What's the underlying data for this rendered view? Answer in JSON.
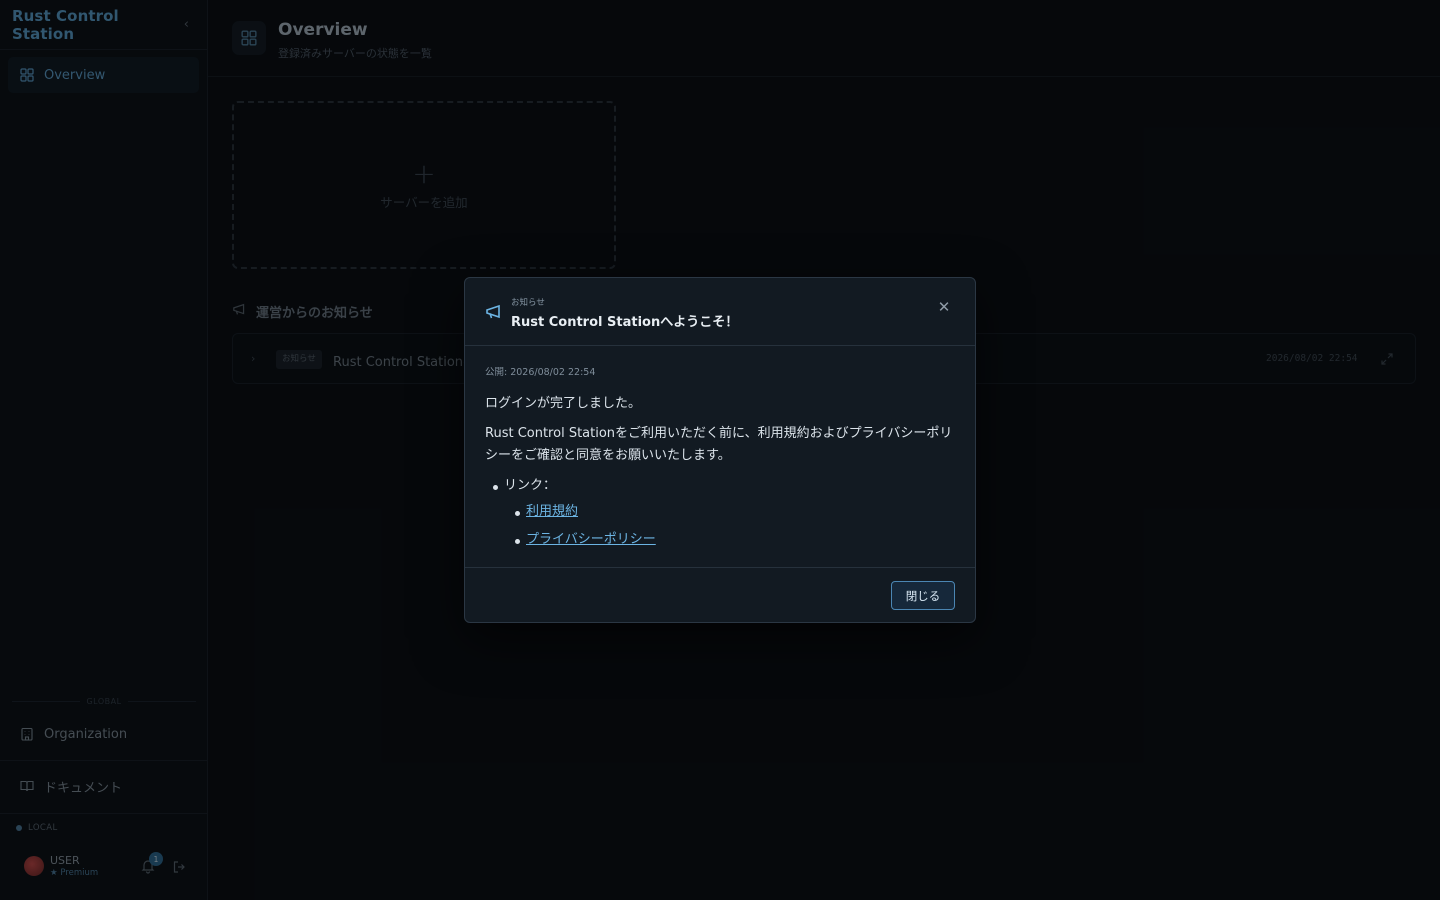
{
  "sidebar": {
    "title": "Rust Control Station",
    "nav": [
      {
        "label": "Overview",
        "icon": "grid-icon",
        "active": true
      },
      {
        "label": "Organization",
        "icon": "building-icon",
        "active": false
      },
      {
        "label": "ドキュメント",
        "icon": "book-icon",
        "active": false
      }
    ],
    "section_label": "GLOBAL",
    "env_label": "LOCAL",
    "user": {
      "name": "USER",
      "plan": "★ Premium",
      "notifications": "1"
    }
  },
  "header": {
    "title": "Overview",
    "subtitle": "登録済みサーバーの状態を一覧"
  },
  "main": {
    "add_server_label": "サーバーを追加",
    "announcements": {
      "heading": "運営からのお知らせ",
      "items": [
        {
          "tag": "お知らせ",
          "title": "Rust Control Stationへ",
          "date": "2026/08/02 22:54"
        }
      ]
    }
  },
  "modal": {
    "kicker": "お知らせ",
    "title": "Rust Control Stationへようこそ！",
    "published": "公開: 2026/08/02 22:54",
    "p1": "ログインが完了しました。",
    "p2": "Rust Control Stationをご利用いただく前に、利用規約およびプライバシーポリシーをご確認と同意をお願いいたします。",
    "links_label": "リンク：",
    "links": [
      "利用規約",
      "プライバシーポリシー"
    ],
    "close_label": "閉じる"
  },
  "colors": {
    "accent": "#5a9fcc",
    "link": "#6cb4e3",
    "background": "#0b1015",
    "modal_bg": "#121a22"
  }
}
